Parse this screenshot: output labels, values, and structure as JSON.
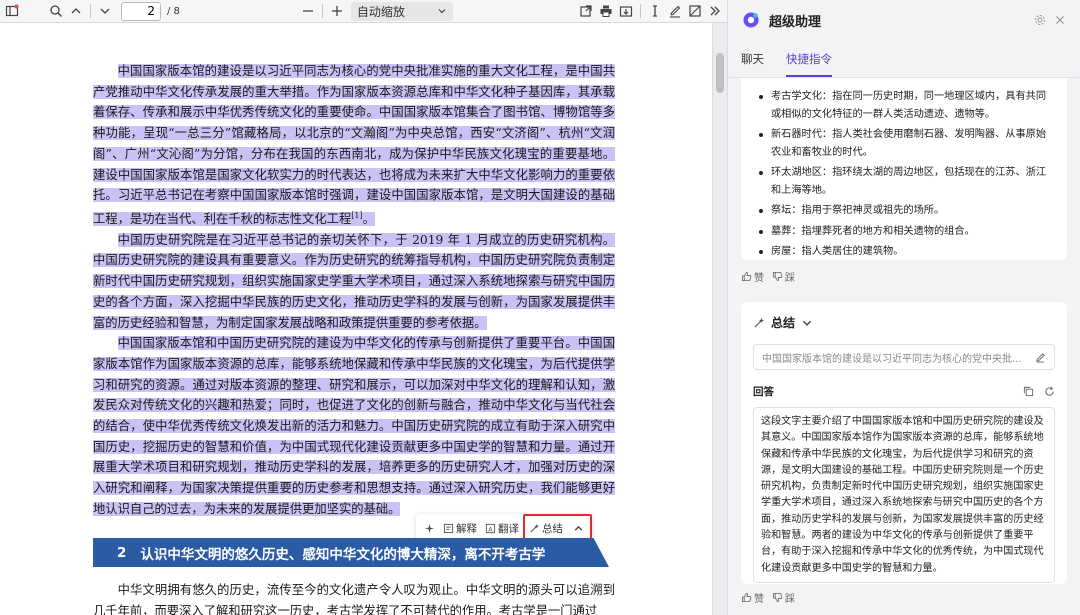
{
  "toolbar": {
    "page_current": "2",
    "page_total": "/ 8",
    "zoom_value": "自动缩放"
  },
  "document": {
    "para1": "中国国家版本馆的建设是以习近平同志为核心的党中央批准实施的重大文化工程，是中国共产党推动中华文化传承发展的重大举措。作为国家版本资源总库和中华文化种子基因库，其承载着保存、传承和展示中华优秀传统文化的重要使命。中国国家版本馆集合了图书馆、博物馆等多种功能，呈现“一总三分”馆藏格局，以北京的“文瀚阁”为中央总馆，西安“文济阁”、杭州“文润阁”、广州“文沁阁”为分馆，分布在我国的东西南北，成为保护中华民族文化瑰宝的重要基地。建设中国国家版本馆是国家文化软实力的时代表达，也将成为未来扩大中华文化影响力的重要依托。习近平总书记在考察中国国家版本馆时强调，建设中国国家版本馆，是文明大国建设的基础工程，是功在当代、利在千秋的标志性文化工程",
    "para1_sup": "[1]",
    "para1_end": "。",
    "para2": "中国历史研究院是在习近平总书记的亲切关怀下，于 2019 年 1 月成立的历史研究机构。中国历史研究院的建设具有重要意义。作为历史研究的统筹指导机构，中国历史研究院负责制定新时代中国历史研究规划，组织实施国家史学重大学术项目，通过深入系统地探索与研究中国历史的各个方面，深入挖掘中华民族的历史文化，推动历史学科的发展与创新，为国家发展提供丰富的历史经验和智慧，为制定国家发展战略和政策提供重要的参考依据。",
    "para3": "中国国家版本馆和中国历史研究院的建设为中华文化的传承与创新提供了重要平台。中国国家版本馆作为国家版本资源的总库，能够系统地保藏和传承中华民族的文化瑰宝，为后代提供学习和研究的资源。通过对版本资源的整理、研究和展示，可以加深对中华文化的理解和认知，激发民众对传统文化的兴趣和热爱；同时，也促进了文化的创新与融合，推动中华文化与当代社会的结合，使中华优秀传统文化焕发出新的活力和魅力。中国历史研究院的成立有助于深入研究中国历史，挖掘历史的智慧和价值，为中国式现代化建设贡献更多中国史学的智慧和力量。通过开展重大学术项目和研究规划，推动历史学科的发展，培养更多的历史研究人才，加强对历史的深入研究和阐释，为国家决策提供重要的历史参考和思想支持。通过深入研究历史，我们能够更好地认识自己的过去，为未来的发展提供更加坚实的基础。",
    "heading_num": "2",
    "heading_text": "认识中华文明的悠久历史、感知中华文化的博大精深，离不开考古学",
    "para4": "中华文明拥有悠久的历史，流传至今的文化遗产令人叹为观止。中华文明的源头可以追溯到几千年前，而要深入了解和研究这一历史，考古学发挥了不可替代的作用。考古学是一门通过"
  },
  "float_bar": {
    "explain": "解释",
    "translate": "翻译",
    "summary": "总结"
  },
  "panel": {
    "title": "超级助理",
    "tabs": [
      "聊天",
      "快捷指令"
    ],
    "bullets": [
      "考古学文化：指在同一历史时期，同一地理区域内，具有共同或相似的文化特征的一群人类活动遗迹、遗物等。",
      "新石器时代：指人类社会使用磨制石器、发明陶器、从事原始农业和畜牧业的时代。",
      "环太湖地区：指环绕太湖的周边地区，包括现在的江苏、浙江和上海等地。",
      "祭坛：指用于祭祀神灵或祖先的场所。",
      "墓葬：指埋葬死者的地方和相关遗物的组合。",
      "房屋：指人类居住的建筑物。"
    ],
    "like": "赞",
    "dislike": "踩",
    "summary_title": "总结",
    "query_text": "中国国家版本馆的建设是以习近平同志为核心的党中央批...",
    "answer_label": "回答",
    "answer_text": "这段文字主要介绍了中国国家版本馆和中国历史研究院的建设及其意义。中国国家版本馆作为国家版本资源的总库，能够系统地保藏和传承中华民族的文化瑰宝，为后代提供学习和研究的资源，是文明大国建设的基础工程。中国历史研究院则是一个历史研究机构，负责制定新时代中国历史研究规划，组织实施国家史学重大学术项目，通过深入系统地探索与研究中国历史的各个方面，推动历史学科的发展与创新，为国家发展提供丰富的历史经验和智慧。两者的建设为中华文化的传承与创新提供了重要平台，有助于深入挖掘和传承中华文化的优秀传统，为中国式现代化建设贡献更多中国史学的智慧和力量。"
  }
}
